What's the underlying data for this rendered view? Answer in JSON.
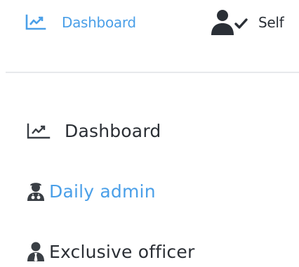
{
  "topbar": {
    "tabs": [
      {
        "label": "Dashboard",
        "icon": "chart-line-icon",
        "active": true
      },
      {
        "label": "Self",
        "icon": "user-check-icon",
        "active": false
      }
    ]
  },
  "sidebar": {
    "items": [
      {
        "label": "Dashboard",
        "icon": "chart-line-icon",
        "active": false
      },
      {
        "label": "Daily admin",
        "icon": "user-doctor-icon",
        "active": true
      },
      {
        "label": "Exclusive officer",
        "icon": "user-tie-icon",
        "active": false
      }
    ]
  },
  "colors": {
    "accent": "#4a9fe8",
    "text": "#2b2f35",
    "divider": "#e7e9ec"
  }
}
